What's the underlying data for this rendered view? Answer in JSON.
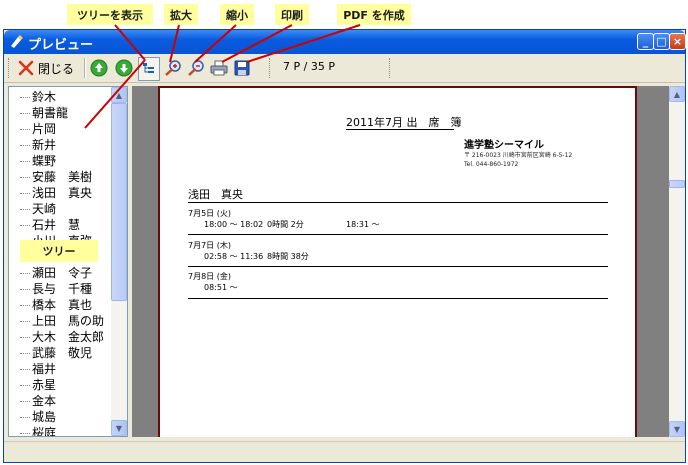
{
  "callouts": {
    "tree_toggle": "ツリーを表示",
    "zoom_in": "拡大",
    "zoom_out": "縮小",
    "print": "印刷",
    "pdf": "PDF を作成",
    "tree": "ツリー"
  },
  "window": {
    "title": "プレビュー",
    "controls": [
      "_",
      "□",
      "×"
    ]
  },
  "toolbar": {
    "close_label": "閉じる",
    "page_info": "7 P / 35 P"
  },
  "tree": {
    "items": [
      "鈴木",
      "朝書龍",
      "片岡",
      "新井",
      "蝶野",
      "安藤　美樹",
      "浅田　真央",
      "天崎",
      "石井　慧",
      "小川　直弥",
      "",
      "瀬田　令子",
      "長与　千種",
      "橋本　真也",
      "上田　馬の助",
      "大木　金太郎",
      "武藤　敬児",
      "福井",
      "赤星",
      "金本",
      "城島",
      "桜庭"
    ]
  },
  "document": {
    "title": "2011年7月 出　席　簿",
    "company": "進学塾シーマイル",
    "address_line1": "〒 216-0023 川崎市宮前区宮崎 6-5-12",
    "address_line2": "Tel. 044-860-1972",
    "person": "浅田　真央",
    "entries": [
      {
        "date": "7月5日 (火)",
        "time": "18:00 ～ 18:02",
        "duration": "0時間 2分",
        "extra": "18:31 ～"
      },
      {
        "date": "7月7日 (木)",
        "time": "02:58 ～ 11:36",
        "duration": "8時間 38分",
        "extra": ""
      },
      {
        "date": "7月8日 (金)",
        "time": "08:51 ～",
        "duration": "",
        "extra": ""
      }
    ]
  },
  "colors": {
    "titlebar": "#0a5ce0",
    "callout_bg": "#ffff9e",
    "callout_line": "#cc0000",
    "page_border": "#6a0a0a"
  }
}
